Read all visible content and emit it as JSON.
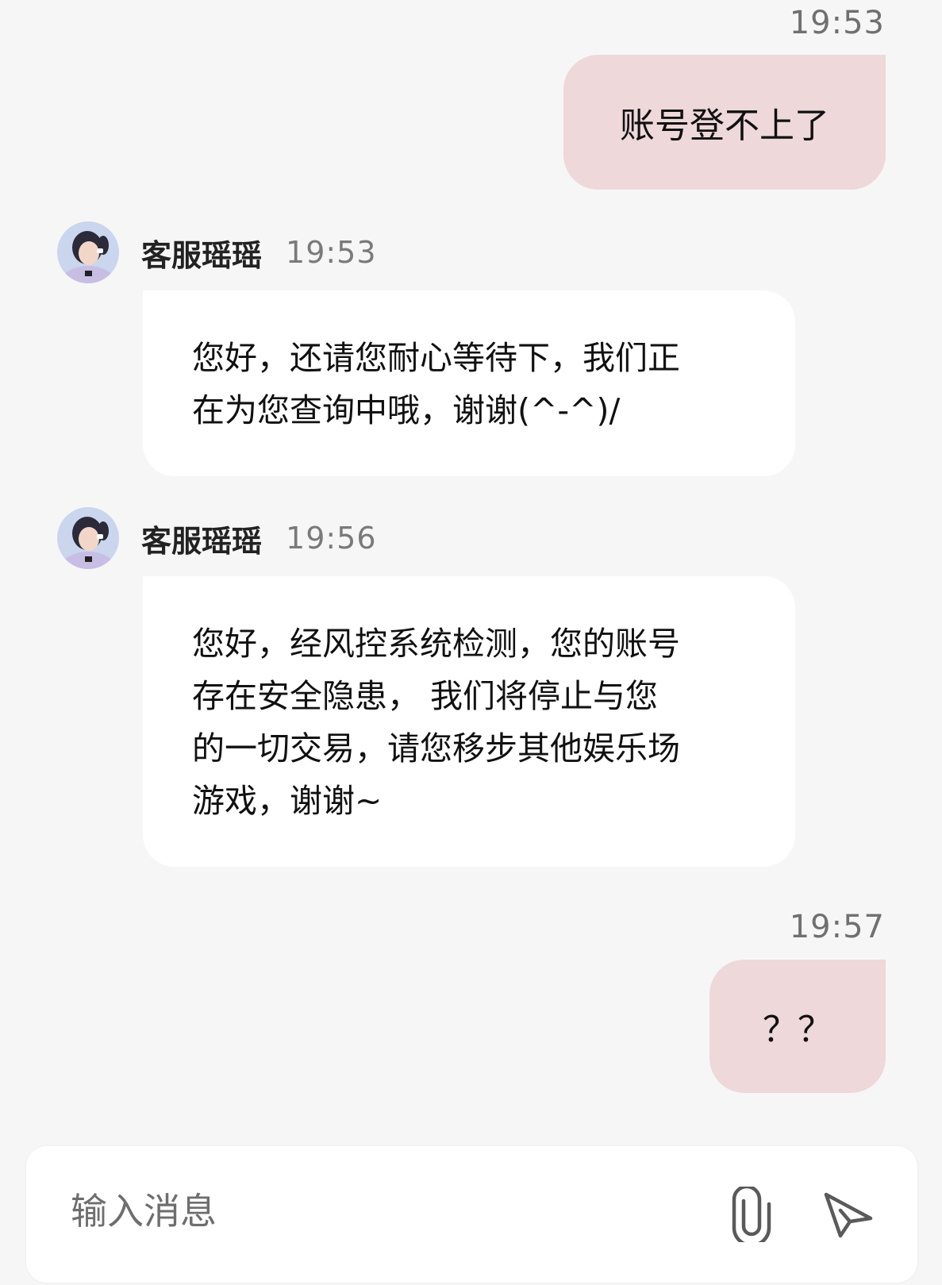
{
  "messages": [
    {
      "direction": "outgoing",
      "time": "19:53",
      "text": "账号登不上了"
    },
    {
      "direction": "incoming",
      "sender": "客服瑶瑶",
      "time": "19:53",
      "lines": [
        "您好，还请您耐心等待下，我们正",
        "在为您查询中哦，谢谢(^-^)/"
      ]
    },
    {
      "direction": "incoming",
      "sender": "客服瑶瑶",
      "time": "19:56",
      "lines": [
        "您好，经风控系统检测，您的账号",
        "存在安全隐患， 我们将停止与您",
        "的一切交易，请您移步其他娱乐场",
        "游戏，谢谢~"
      ]
    },
    {
      "direction": "outgoing",
      "time": "19:57",
      "text": "？？"
    }
  ],
  "composer": {
    "placeholder": "输入消息",
    "attach_icon": "paperclip-icon",
    "send_icon": "send-icon"
  },
  "colors": {
    "background": "#f7f6f7",
    "outgoing_bubble": "#eed8d9",
    "incoming_bubble": "#ffffff",
    "timestamp": "#707070"
  }
}
